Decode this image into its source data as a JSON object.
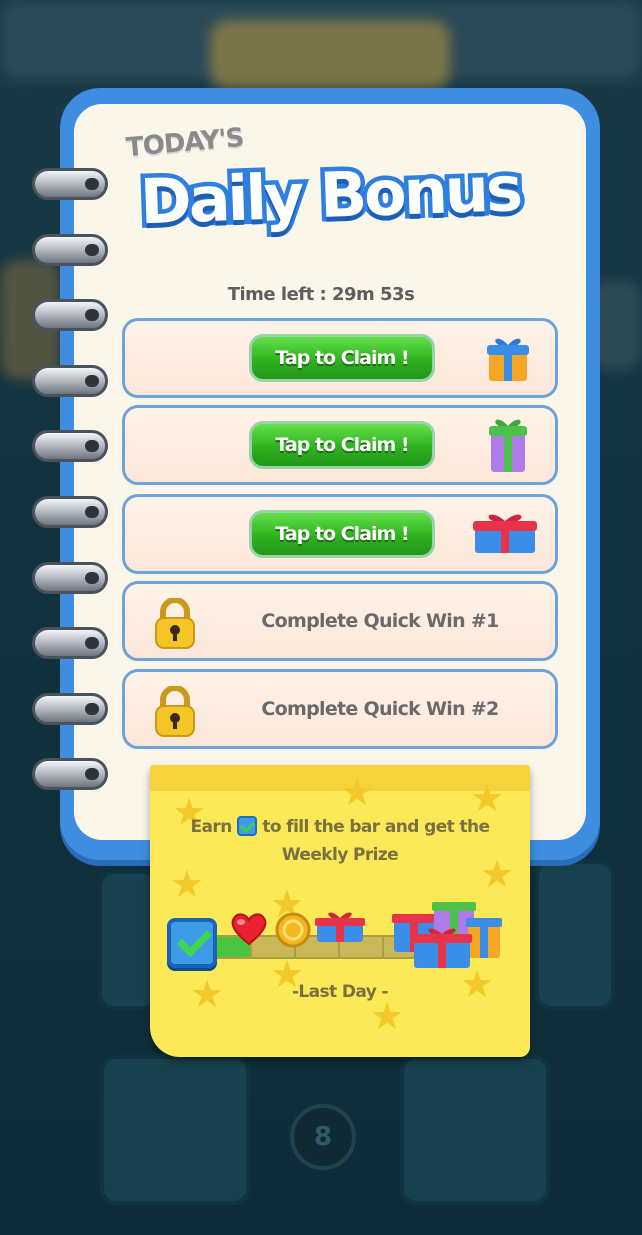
{
  "title": {
    "small": "TODAY'S",
    "big": "Daily Bonus"
  },
  "timer": "Time left : 29m 53s",
  "rewards": [
    {
      "type": "claim",
      "label": "Tap to Claim !",
      "gift_color": "blue-orange"
    },
    {
      "type": "claim",
      "label": "Tap to Claim !",
      "gift_color": "purple-green"
    },
    {
      "type": "claim",
      "label": "Tap to Claim !",
      "gift_color": "blue-red"
    },
    {
      "type": "locked",
      "label": "Complete Quick Win #1",
      "icon": "lock-icon"
    },
    {
      "type": "locked",
      "label": "Complete Quick Win #2",
      "icon": "lock-icon"
    }
  ],
  "sticky": {
    "text_before": "Earn",
    "text_after": "to fill the bar and get the",
    "text_line2": "Weekly Prize",
    "progress": 0.2,
    "milestones": [
      "heart-icon",
      "coin-icon",
      "gift-icon"
    ],
    "final_prize": "gift-pile-icon",
    "footer": "-Last Day -"
  },
  "background_badge": "8",
  "colors": {
    "notebook_blue": "#3e8de0",
    "claim_green": "#2fb21f",
    "sticky_yellow": "#fbe957"
  }
}
